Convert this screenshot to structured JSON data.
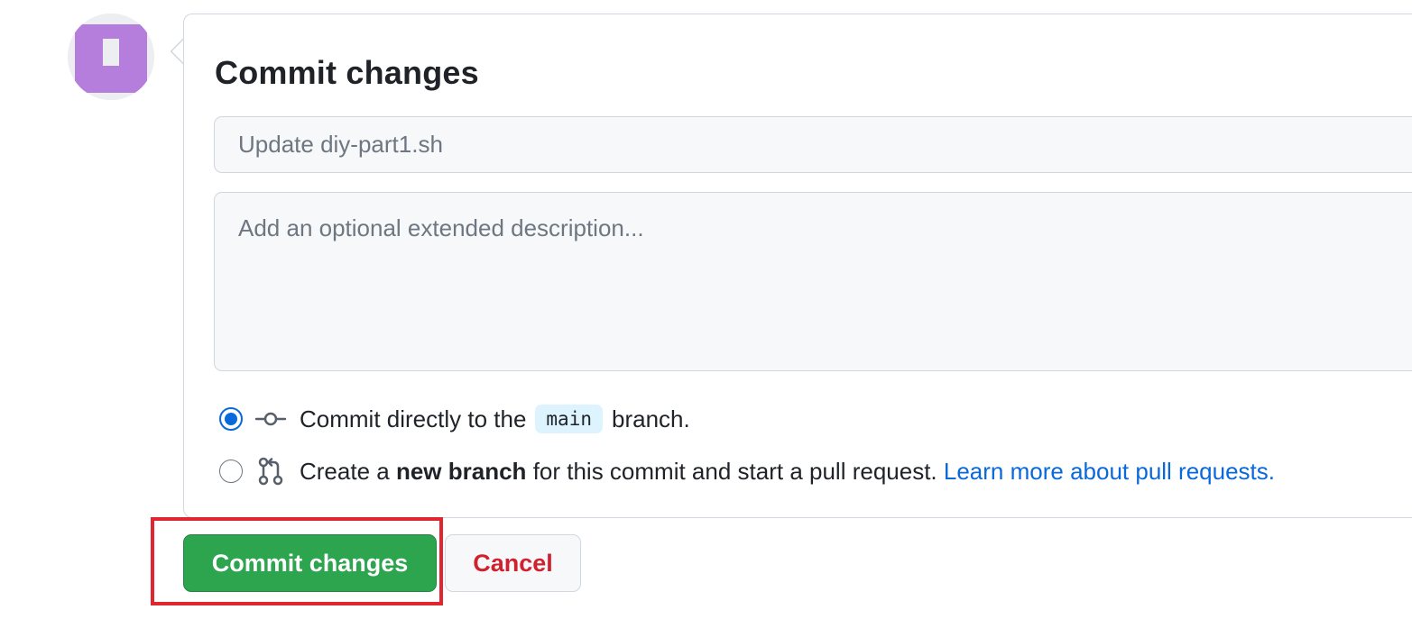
{
  "form": {
    "title": "Commit changes",
    "summary_placeholder": "Update diy-part1.sh",
    "description_placeholder": "Add an optional extended description..."
  },
  "options": {
    "direct": {
      "prefix": "Commit directly to the",
      "branch": "main",
      "suffix": "branch.",
      "selected": true
    },
    "new_branch": {
      "prefix": "Create a",
      "bold": "new branch",
      "suffix": "for this commit and start a pull request.",
      "link": "Learn more about pull requests.",
      "selected": false
    }
  },
  "buttons": {
    "commit_label": "Commit changes",
    "cancel_label": "Cancel"
  },
  "colors": {
    "accent": "#0969da",
    "commit_button": "#2da44e",
    "cancel_text": "#cf222e",
    "highlight": "#e0262f",
    "avatar": "#b57edc"
  },
  "icons": {
    "avatar": "identicon-avatar",
    "commit": "git-commit-icon",
    "pull_request": "git-pull-request-icon"
  }
}
